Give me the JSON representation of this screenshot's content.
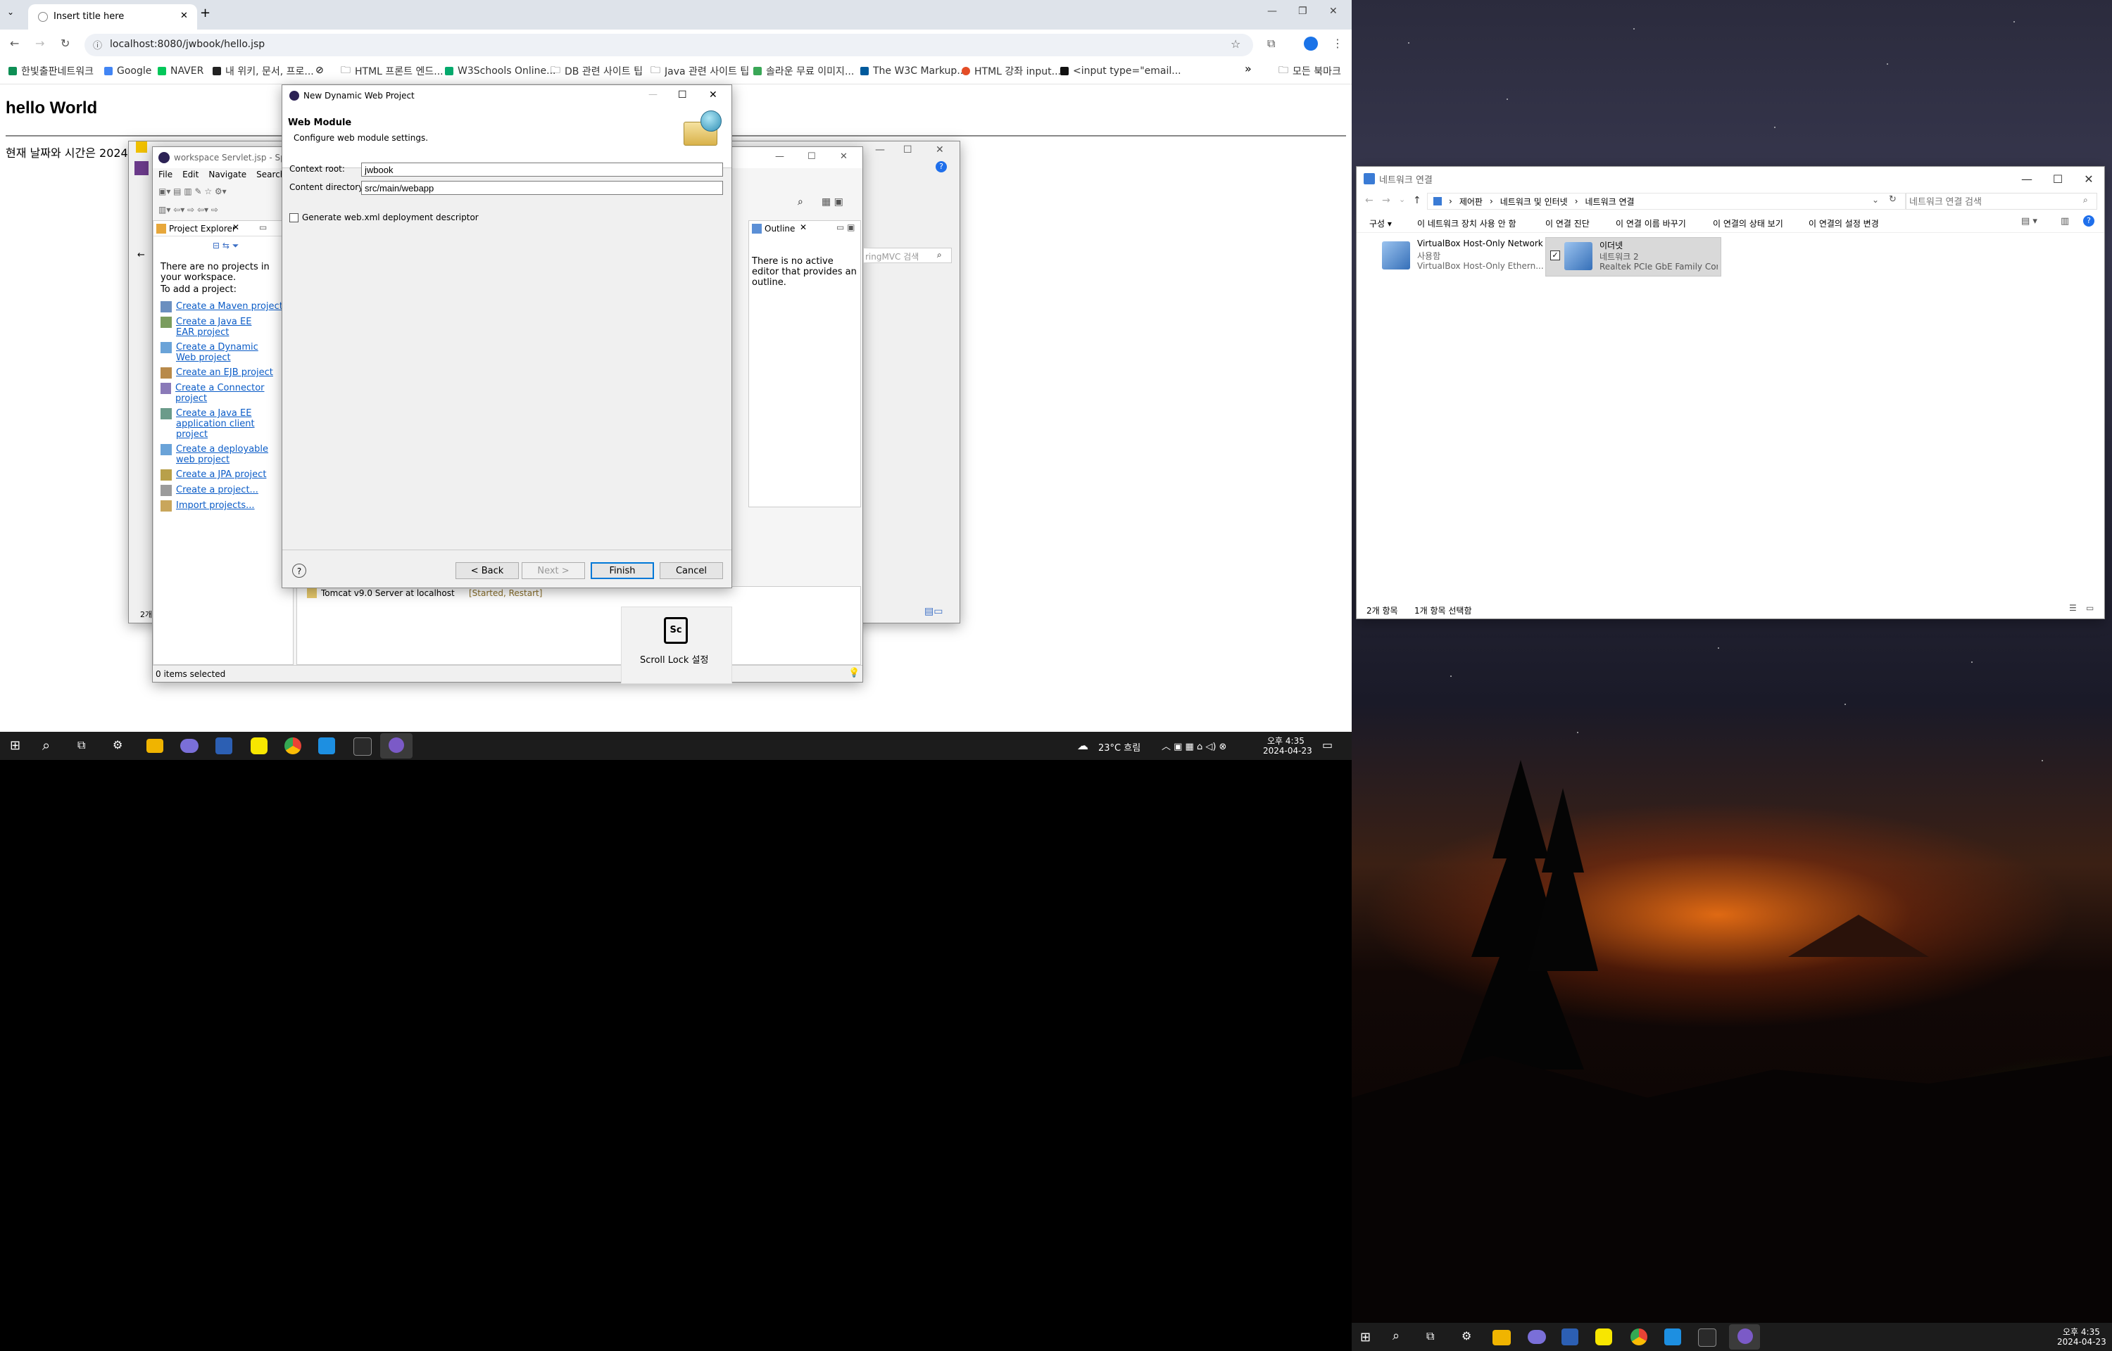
{
  "browser": {
    "tab_title": "Insert title here",
    "url": "localhost:8080/jwbook/hello.jsp",
    "bookmarks": [
      "한빛출판네트워크",
      "Google",
      "NAVER",
      "내 위키, 문서, 프로...",
      "HTML 프론트 엔드...",
      "W3Schools Online...",
      "DB 관련 사이트 팁",
      "Java 관련 사이트 팁",
      "솔라운 무료 이미지...",
      "The W3C Markup...",
      "HTML 강좌 input...",
      "<input type=\"email..."
    ],
    "bookmarks_more": "»",
    "all_bookmarks": "모든 북마크",
    "page_heading": "hello World",
    "page_text": "현재 날짜와 시간은 2024"
  },
  "eclipse": {
    "title": "workspace Servlet.jsp - Spring",
    "menu": [
      "File",
      "Edit",
      "Navigate",
      "Search"
    ],
    "project_explorer_tab": "Project Explorer",
    "empty_msg_1": "There are no projects in your workspace.",
    "empty_msg_2": "To add a project:",
    "links": [
      "Create a Maven project",
      "Create a Java EE EAR project",
      "Create a Dynamic Web project",
      "Create an EJB project",
      "Create a Connector project",
      "Create a Java EE application client project",
      "Create a deployable web project",
      "Create a JPA project",
      "Create a project...",
      "Import projects..."
    ],
    "outline_tab": "Outline",
    "outline_msg": "There is no active editor that provides an outline.",
    "search_placeholder": "ringMVC 검색",
    "server_row": "Tomcat v9.0 Server at localhost",
    "server_status": "[Started, Restart]",
    "status_bar": "0 items selected",
    "side_count": "2개"
  },
  "dialog": {
    "title": "New Dynamic Web Project",
    "heading": "Web Module",
    "subheading": "Configure web module settings.",
    "context_root_label": "Context root:",
    "context_root_value": "jwbook",
    "content_dir_label": "Content directory:",
    "content_dir_value": "src/main/webapp",
    "generate_label": "Generate web.xml deployment descriptor",
    "back": "< Back",
    "next": "Next >",
    "finish": "Finish",
    "cancel": "Cancel"
  },
  "scroll_lock": {
    "key": "Sc",
    "label": "Scroll Lock 설정"
  },
  "network": {
    "title": "네트워크 연결",
    "breadcrumb": [
      "제어판",
      "네트워크 및 인터넷",
      "네트워크 연결"
    ],
    "search_placeholder": "네트워크 연결 검색",
    "toolbar": [
      "구성 ▾",
      "이 네트워크 장치 사용 안 함",
      "이 연결 진단",
      "이 연결 이름 바꾸기",
      "이 연결의 상태 보기",
      "이 연결의 설정 변경"
    ],
    "adapters": [
      {
        "name": "VirtualBox Host-Only Network",
        "status": "사용함",
        "device": "VirtualBox Host-Only Ethern..."
      },
      {
        "name": "이더넷",
        "status": "네트워크 2",
        "device": "Realtek PCIe GbE Family Con..."
      }
    ],
    "status_items": "2개 항목",
    "status_selected": "1개 항목 선택함"
  },
  "taskbar_left": {
    "weather": "23°C 흐림",
    "time": "오후 4:35",
    "date": "2024-04-23"
  },
  "taskbar_right": {
    "time": "오후 4:35",
    "date": "2024-04-23"
  },
  "colors": {
    "accent": "#0b5cc7",
    "tab_strip": "#dee3ea",
    "taskbar": "#1c1c1c"
  }
}
